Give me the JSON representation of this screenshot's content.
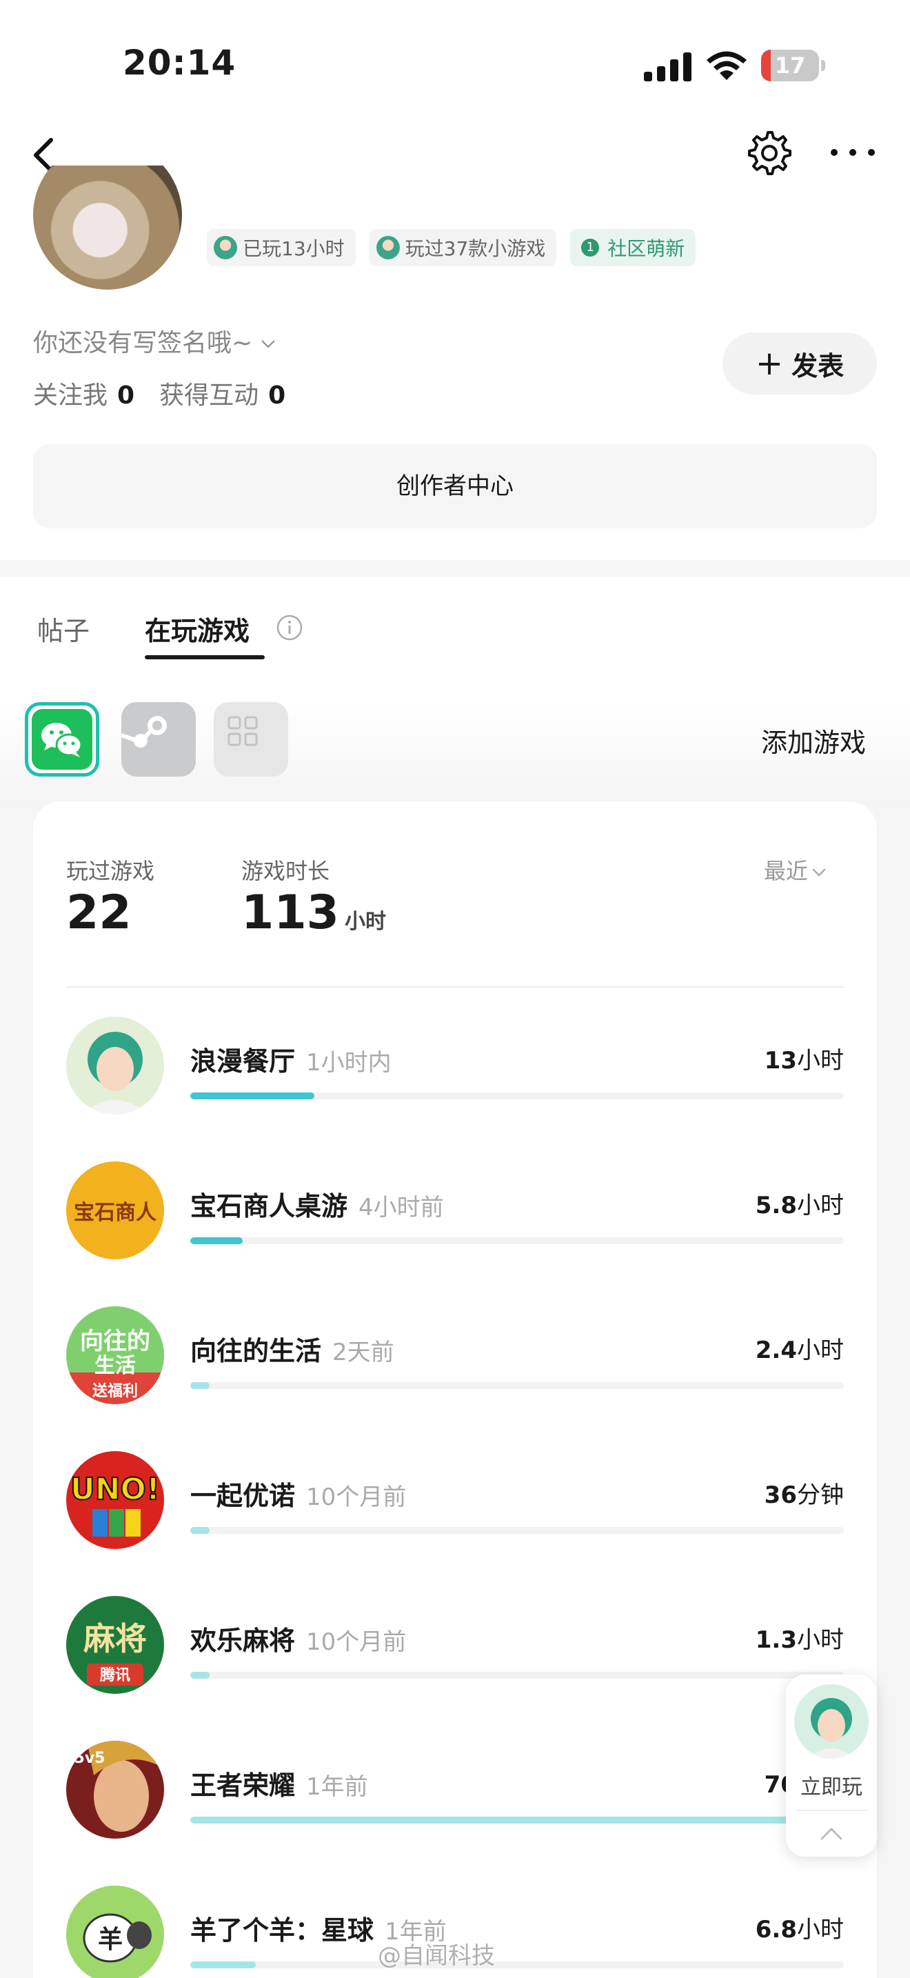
{
  "status_bar": {
    "time": "20:14",
    "battery": "17",
    "battery_level_percent": 17
  },
  "profile": {
    "badges": [
      {
        "label": "已玩13小时"
      },
      {
        "label": "玩过37款小游戏"
      },
      {
        "label": "社区萌新",
        "level": "1"
      }
    ],
    "signature": "你还没有写签名哦~",
    "stats": [
      {
        "label": "关注我",
        "value": "0"
      },
      {
        "label": "获得互动",
        "value": "0"
      }
    ],
    "post_button": "发表",
    "creator_center": "创作者中心"
  },
  "tabs": [
    {
      "label": "帖子",
      "active": false
    },
    {
      "label": "在玩游戏",
      "active": true
    }
  ],
  "platforms": [
    {
      "icon": "wechat-icon",
      "selected": true
    },
    {
      "icon": "steam-icon",
      "selected": false
    },
    {
      "icon": "grid-icon",
      "selected": false
    }
  ],
  "add_game": "添加游戏",
  "summary": {
    "played_label": "玩过游戏",
    "played_value": "22",
    "duration_label": "游戏时长",
    "duration_value": "113",
    "duration_unit": "小时",
    "sort": "最近"
  },
  "games": [
    {
      "name": "浪漫餐厅",
      "when": "1小时内",
      "duration": "13",
      "unit": "小时",
      "progress": 0.19,
      "color": "#3ec6d4",
      "icon": "romantic-restaurant-icon"
    },
    {
      "name": "宝石商人桌游",
      "when": "4小时前",
      "duration": "5.8",
      "unit": "小时",
      "progress": 0.08,
      "color": "#3ec6d4",
      "icon": "gem-merchant-icon"
    },
    {
      "name": "向往的生活",
      "when": "2天前",
      "duration": "2.4",
      "unit": "小时",
      "progress": 0.03,
      "color": "#a6e4ea",
      "icon": "longing-life-icon"
    },
    {
      "name": "一起优诺",
      "when": "10个月前",
      "duration": "36",
      "unit": "分钟",
      "progress": 0.03,
      "color": "#a6e4ea",
      "icon": "uno-icon"
    },
    {
      "name": "欢乐麻将",
      "when": "10个月前",
      "duration": "1.3",
      "unit": "小时",
      "progress": 0.03,
      "color": "#a6e4ea",
      "icon": "mahjong-icon"
    },
    {
      "name": "王者荣耀",
      "when": "1年前",
      "duration": "70",
      "unit": "小时",
      "progress": 1.0,
      "color": "#a6e4ea",
      "icon": "honor-of-kings-icon"
    },
    {
      "name": "羊了个羊：星球",
      "when": "1年前",
      "duration": "6.8",
      "unit": "小时",
      "progress": 0.1,
      "color": "#a6e4ea",
      "icon": "sheep-icon"
    }
  ],
  "float_widget": {
    "label": "立即玩"
  },
  "watermark": "@自闻科技"
}
